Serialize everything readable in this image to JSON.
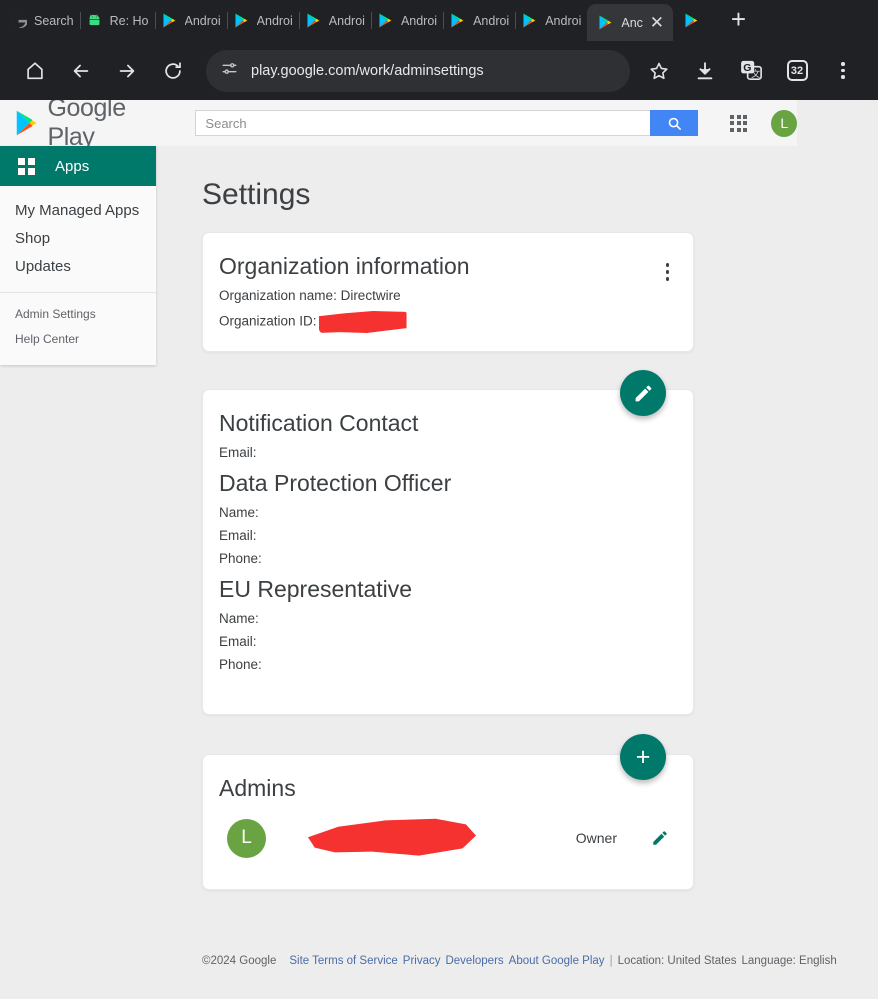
{
  "browser": {
    "tabs": [
      {
        "label": "Search",
        "icon": "google-g-icon",
        "active": false
      },
      {
        "label": "Re: Ho",
        "icon": "android-robot-icon",
        "active": false
      },
      {
        "label": "Androi",
        "icon": "google-play-icon",
        "active": false
      },
      {
        "label": "Androi",
        "icon": "google-play-icon",
        "active": false
      },
      {
        "label": "Androi",
        "icon": "google-play-icon",
        "active": false
      },
      {
        "label": "Androi",
        "icon": "google-play-icon",
        "active": false
      },
      {
        "label": "Androi",
        "icon": "google-play-icon",
        "active": false
      },
      {
        "label": "Androi",
        "icon": "google-play-icon",
        "active": false
      },
      {
        "label": "Anc",
        "icon": "google-play-icon",
        "active": true
      }
    ],
    "new_tab_label": "+",
    "close_tab_label": "✕",
    "toolbar": {
      "home_icon": "home-icon",
      "back_icon": "back-arrow-icon",
      "forward_icon": "forward-arrow-icon",
      "reload_icon": "reload-icon",
      "site_settings_icon": "tune-icon",
      "url": "play.google.com/work/adminsettings",
      "bookmark_icon": "star-icon",
      "download_icon": "download-icon",
      "translate_icon": "translate-icon",
      "tab_count": "32",
      "menu_icon": "three-dot-menu-icon"
    },
    "colors": {
      "chrome_bg": "#202125",
      "tab_active_bg": "#35363a",
      "omnibox_bg": "#2f3034"
    }
  },
  "gp_header": {
    "logo_text": "Google Play",
    "search_placeholder": "Search",
    "search_value": "",
    "search_button_icon": "search-icon",
    "apps_grid_icon": "apps-grid-icon",
    "avatar_letter": "L"
  },
  "sidebar": {
    "apps_label": "Apps",
    "items": [
      {
        "label": "My Managed Apps"
      },
      {
        "label": "Shop"
      },
      {
        "label": "Updates"
      }
    ],
    "secondary_items": [
      {
        "label": "Admin Settings"
      },
      {
        "label": "Help Center"
      }
    ]
  },
  "main": {
    "page_title": "Settings",
    "org_card": {
      "title": "Organization information",
      "name_line": "Organization name: Directwire",
      "id_line": "Organization ID:",
      "id_redacted": true,
      "menu_icon": "three-dot-menu-icon"
    },
    "notification_card": {
      "title": "Notification Contact",
      "email_label": "Email:",
      "dpo_title": "Data Protection Officer",
      "dpo_name_label": "Name:",
      "dpo_email_label": "Email:",
      "dpo_phone_label": "Phone:",
      "eu_title": "EU Representative",
      "eu_name_label": "Name:",
      "eu_email_label": "Email:",
      "eu_phone_label": "Phone:",
      "edit_fab_icon": "pencil-icon"
    },
    "admins_card": {
      "title": "Admins",
      "add_fab_label": "+",
      "rows": [
        {
          "avatar_letter": "L",
          "name_redacted": true,
          "role": "Owner",
          "edit_icon": "pencil-icon"
        }
      ]
    }
  },
  "footer": {
    "copyright": "©2024 Google",
    "links": [
      "Site Terms of Service",
      "Privacy",
      "Developers",
      "About Google Play"
    ],
    "separator": "|",
    "location": "Location: United States",
    "language": "Language: English"
  },
  "colors": {
    "accent_teal": "#00796b",
    "avatar_green": "#6aa442",
    "redaction_red": "#f5322f",
    "search_button_blue": "#4285f4",
    "link_blue": "#4a6da7"
  }
}
